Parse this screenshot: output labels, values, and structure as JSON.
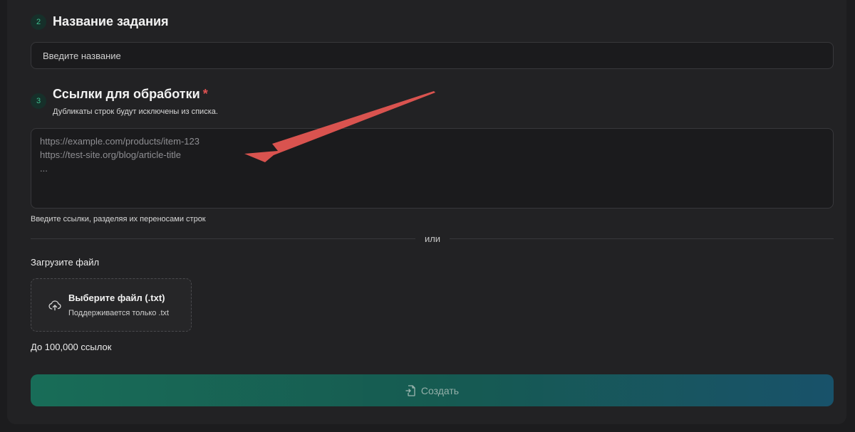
{
  "sections": {
    "name": {
      "step": "2",
      "title": "Название задания",
      "input_placeholder": "Введите название"
    },
    "links": {
      "step": "3",
      "title": "Ссылки для обработки",
      "required_mark": "*",
      "subtitle": "Дубликаты строк будут исключены из списка.",
      "textarea_placeholder": "https://example.com/products/item-123\nhttps://test-site.org/blog/article-title\n...",
      "hint": "Введите ссылки, разделяя их переносами строк"
    }
  },
  "divider": {
    "label": "или"
  },
  "upload": {
    "label": "Загрузите файл",
    "button_title": "Выберите файл (.txt)",
    "button_subtitle": "Поддерживается только .txt",
    "icon": "cloud-upload-icon",
    "limit": "До 100,000 ссылок"
  },
  "submit": {
    "label": "Создать",
    "icon": "file-import-icon"
  },
  "annotation": {
    "color": "#d9534f",
    "icon": "arrow-pointer"
  },
  "colors": {
    "background": "#1c1c1e",
    "panel": "#222224",
    "accent": "#3fbf8f",
    "required": "#e05252",
    "button_gradient_start": "#17735c",
    "button_gradient_end": "#175670"
  }
}
